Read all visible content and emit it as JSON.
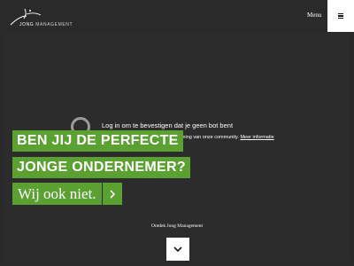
{
  "header": {
    "logo": {
      "text_primary": "JONG",
      "text_secondary": "MANAGEMENT"
    },
    "menu_label": "Menu",
    "menu_icon": "hamburger-icon"
  },
  "captcha": {
    "icon": "captcha-spinner-icon",
    "title": "Log in om te bevestigen dat je geen bot bent",
    "subtitle": "aan de bescherming van onze community.",
    "link": "Meer informatie"
  },
  "hero": {
    "line1": "BEN JIJ DE PERFECTE",
    "line2": "JONGE ONDERNEMER?",
    "line3": "Wij ook niet.",
    "arrow_icon": "chevron-right-icon"
  },
  "footer": {
    "discover_label": "Ontdek Jong Management",
    "scroll_icon": "chevron-down-icon"
  },
  "colors": {
    "background": "#2a2a2a",
    "accent": "#5aa132",
    "text": "#ffffff"
  }
}
